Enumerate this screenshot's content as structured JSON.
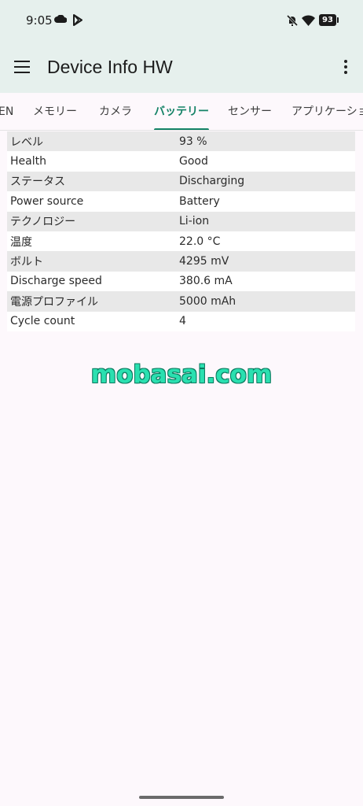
{
  "status_bar": {
    "time": "9:05",
    "battery_level": "93",
    "icons": [
      "cloud-icon",
      "play-store-icon",
      "mute-icon",
      "wifi-icon",
      "battery-icon"
    ]
  },
  "app_bar": {
    "title": "Device Info HW",
    "icons": [
      "menu-icon",
      "more-vert-icon"
    ]
  },
  "tabs": [
    {
      "label": "EN",
      "active": false
    },
    {
      "label": "メモリー",
      "active": false
    },
    {
      "label": "カメラ",
      "active": false
    },
    {
      "label": "バッテリー",
      "active": true
    },
    {
      "label": "センサー",
      "active": false
    },
    {
      "label": "アプリケーション",
      "active": false
    }
  ],
  "battery_table": [
    {
      "label": "レベル",
      "value": "93 %"
    },
    {
      "label": "Health",
      "value": "Good"
    },
    {
      "label": "ステータス",
      "value": "Discharging"
    },
    {
      "label": "Power source",
      "value": "Battery"
    },
    {
      "label": "テクノロジー",
      "value": "Li-ion"
    },
    {
      "label": "温度",
      "value": "22.0 °C"
    },
    {
      "label": "ボルト",
      "value": "4295 mV"
    },
    {
      "label": "Discharge speed",
      "value": "380.6 mA"
    },
    {
      "label": "電源プロファイル",
      "value": "5000 mAh"
    },
    {
      "label": "Cycle count",
      "value": "4"
    }
  ],
  "watermark": "mobasai.com",
  "colors": {
    "accent": "#158367",
    "app_bar_bg": "#e6f0ed",
    "row_shade": "#e8e8e8",
    "watermark": "#2ae0b0"
  }
}
